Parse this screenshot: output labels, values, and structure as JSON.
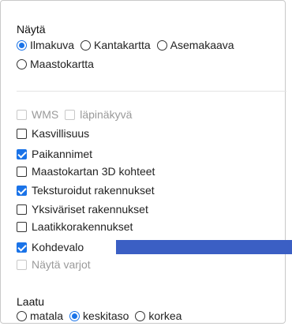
{
  "view": {
    "heading": "Näytä",
    "options": [
      "Ilmakuva",
      "Kantakartta",
      "Asemakaava",
      "Maastokartta"
    ],
    "selected": "Ilmakuva"
  },
  "layers": {
    "wms": "WMS",
    "transparent": "läpinäkyvä",
    "vegetation": "Kasvillisuus",
    "place_names": "Paikannimet",
    "terrain_3d": "Maastokartan 3D kohteet",
    "textured_buildings": "Teksturoidut rakennukset",
    "plain_buildings": "Yksiväriset rakennukset",
    "box_buildings": "Laatikkorakennukset",
    "spotlight": "Kohdevalo",
    "shadows": "Näytä varjot"
  },
  "quality": {
    "heading": "Laatu",
    "options": [
      "matala",
      "keskitaso",
      "korkea"
    ],
    "selected": "keskitaso"
  },
  "colors": {
    "accent": "#1a73e8",
    "slider": "#3b5fc4"
  }
}
